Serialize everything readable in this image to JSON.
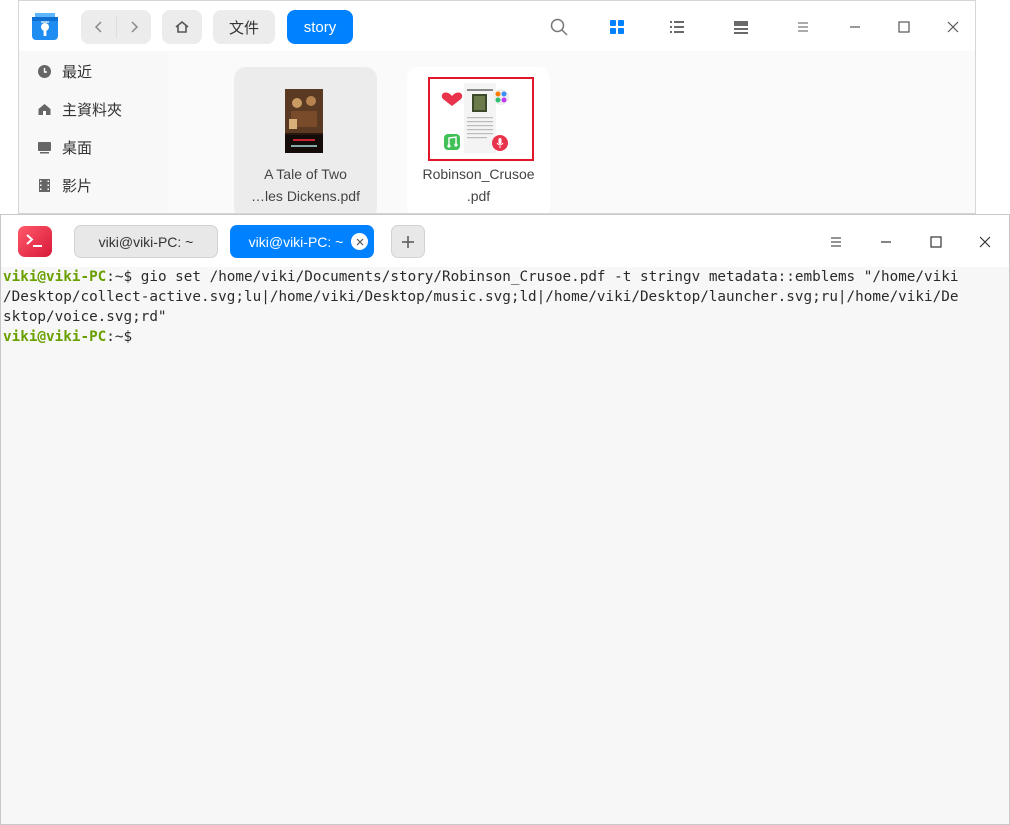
{
  "file_manager": {
    "breadcrumbs": [
      "文件",
      "story"
    ],
    "sidebar": {
      "items": [
        {
          "label": "最近",
          "icon": "clock-icon"
        },
        {
          "label": "主資料夾",
          "icon": "home-icon"
        },
        {
          "label": "桌面",
          "icon": "desktop-icon"
        },
        {
          "label": "影片",
          "icon": "film-icon"
        }
      ]
    },
    "files": [
      {
        "name_line1": "A Tale of Two",
        "name_line2": "…les Dickens.pdf"
      },
      {
        "name_line1": "Robinson_Crusoe",
        "name_line2": ".pdf",
        "selected": true
      }
    ]
  },
  "terminal": {
    "tabs": [
      {
        "label": "viki@viki-PC: ~"
      },
      {
        "label": "viki@viki-PC: ~",
        "active": true
      }
    ],
    "lines": [
      {
        "user": "viki@viki-PC",
        "path": ":~$ ",
        "cmd": "gio set /home/viki/Documents/story/Robinson_Crusoe.pdf -t stringv metadata::emblems \"/home/viki"
      },
      {
        "text": "/Desktop/collect-active.svg;lu|/home/viki/Desktop/music.svg;ld|/home/viki/Desktop/launcher.svg;ru|/home/viki/De"
      },
      {
        "text": "sktop/voice.svg;rd\""
      },
      {
        "user": "viki@viki-PC",
        "path": ":~$",
        "cmd": ""
      }
    ]
  },
  "colors": {
    "accent": "#0081ff",
    "prompt_user": "#69a000",
    "selection_border": "#e0162b"
  }
}
